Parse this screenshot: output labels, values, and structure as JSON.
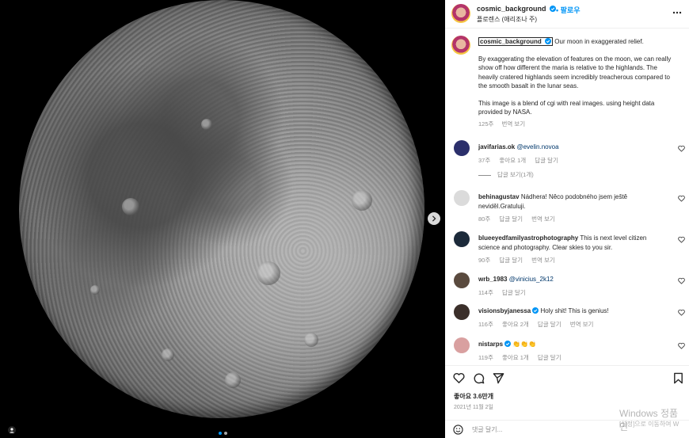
{
  "header": {
    "username": "cosmic_background",
    "follow_label": "팔로우",
    "location": "플로렌스 (애리조나 주)"
  },
  "caption": {
    "username": "cosmic_background",
    "headline": "Our moon in exaggerated relief.",
    "paragraph1": "By exaggerating the elevation of features on the moon, we can really show off how different the maria is relative to the highlands. The heavily cratered highlands seem incredibly treacherous compared to the smooth basalt in the lunar seas.",
    "paragraph2": "This image is a blend of cgi with real images. using height data provided by NASA.",
    "time": "125주",
    "translate": "번역 보기"
  },
  "comments": [
    {
      "user": "javifarias.ok",
      "text": "",
      "mention": "@evelin.novoa",
      "time": "37주",
      "likes": "좋아요 1개",
      "reply": "답글 달기",
      "translate": "",
      "avatar_color": "#2b2f6b",
      "verified": false
    },
    {
      "user": "behinagustav",
      "text": "Nádhera! Něco podobného jsem ještě neviděl.Gratuluji.",
      "mention": "",
      "time": "80주",
      "likes": "",
      "reply": "답글 달기",
      "translate": "번역 보기",
      "avatar_color": "#dbdbdb",
      "verified": false
    },
    {
      "user": "blueeyedfamilyastrophotography",
      "text": "This is next level citizen science and photography. Clear skies to you sir.",
      "mention": "",
      "time": "90주",
      "likes": "",
      "reply": "답글 달기",
      "translate": "번역 보기",
      "avatar_color": "#1c2a3a",
      "verified": false
    },
    {
      "user": "wrb_1983",
      "text": "",
      "mention": "@vinicius_2k12",
      "time": "114주",
      "likes": "",
      "reply": "답글 달기",
      "translate": "",
      "avatar_color": "#5a4a3e",
      "verified": false
    },
    {
      "user": "visionsbyjanessa",
      "text": "Holy shit! This is genius!",
      "mention": "",
      "time": "116주",
      "likes": "좋아요 2개",
      "reply": "답글 달기",
      "translate": "번역 보기",
      "avatar_color": "#3b2f2a",
      "verified": true
    },
    {
      "user": "nistarps",
      "text": "👏👏👏",
      "mention": "",
      "time": "119주",
      "likes": "좋아요 1개",
      "reply": "답글 달기",
      "translate": "",
      "avatar_color": "#d9a0a0",
      "verified": true
    }
  ],
  "replies_toggle": "답글 보기(1개)",
  "actions": {
    "likes": "좋아요 3.6만개",
    "date": "2021년 11월 2일"
  },
  "add_comment": {
    "placeholder": "댓글 달기..."
  },
  "watermark": {
    "line1": "Windows 정품 인",
    "line2": "[설정]으로 이동하여 W"
  },
  "icons": {
    "verified_color": "#0095f6",
    "link_color": "#00376b",
    "muted_color": "#8e8e8e"
  }
}
